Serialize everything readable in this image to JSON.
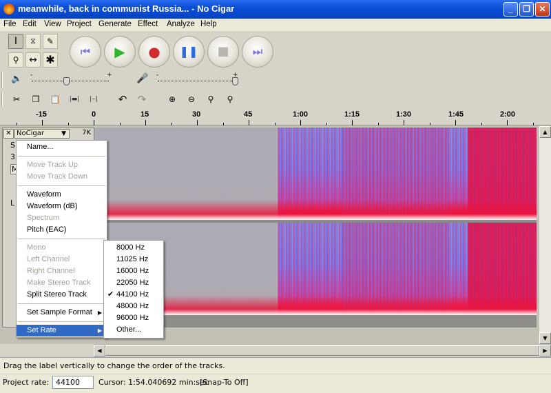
{
  "window": {
    "title": "meanwhile, back in communist Russia... - No Cigar"
  },
  "menubar": [
    "File",
    "Edit",
    "View",
    "Project",
    "Generate",
    "Effect",
    "Analyze",
    "Help"
  ],
  "meter": {
    "plus": "+",
    "minus": "-"
  },
  "ruler": {
    "labels": [
      "-15",
      "0",
      "15",
      "30",
      "45",
      "1:00",
      "1:15",
      "1:30",
      "1:45",
      "2:00"
    ]
  },
  "track": {
    "name": "NoCigar",
    "rate_badge": "7K",
    "panel_letters": [
      "S",
      "3",
      "M",
      "L"
    ]
  },
  "track_menu": {
    "items": [
      {
        "label": "Name...",
        "enabled": true
      },
      {
        "label": "Move Track Up",
        "enabled": false
      },
      {
        "label": "Move Track Down",
        "enabled": false
      },
      {
        "label": "Waveform",
        "enabled": true
      },
      {
        "label": "Waveform (dB)",
        "enabled": true
      },
      {
        "label": "Spectrum",
        "enabled": false
      },
      {
        "label": "Pitch (EAC)",
        "enabled": true
      },
      {
        "label": "Mono",
        "enabled": false
      },
      {
        "label": "Left Channel",
        "enabled": false
      },
      {
        "label": "Right Channel",
        "enabled": false
      },
      {
        "label": "Make Stereo Track",
        "enabled": false
      },
      {
        "label": "Split Stereo Track",
        "enabled": true
      },
      {
        "label": "Set Sample Format",
        "enabled": true
      },
      {
        "label": "Set Rate",
        "enabled": true
      }
    ]
  },
  "rate_submenu": {
    "items": [
      "8000 Hz",
      "11025 Hz",
      "16000 Hz",
      "22050 Hz",
      "44100 Hz",
      "48000 Hz",
      "96000 Hz",
      "Other..."
    ],
    "checked": "44100 Hz"
  },
  "status": {
    "hint": "Drag the label vertically to change the order of the tracks.",
    "project_rate_label": "Project rate:",
    "project_rate_value": "44100",
    "cursor": "Cursor: 1:54.040692 min:sec",
    "snap": "[Snap-To Off]"
  },
  "colors": {
    "title_bar": "#0a4fd6",
    "menu_highlight": "#316ac5",
    "spectrum_hot": "#e81448",
    "spectrum_cool": "#3f6ef2"
  }
}
